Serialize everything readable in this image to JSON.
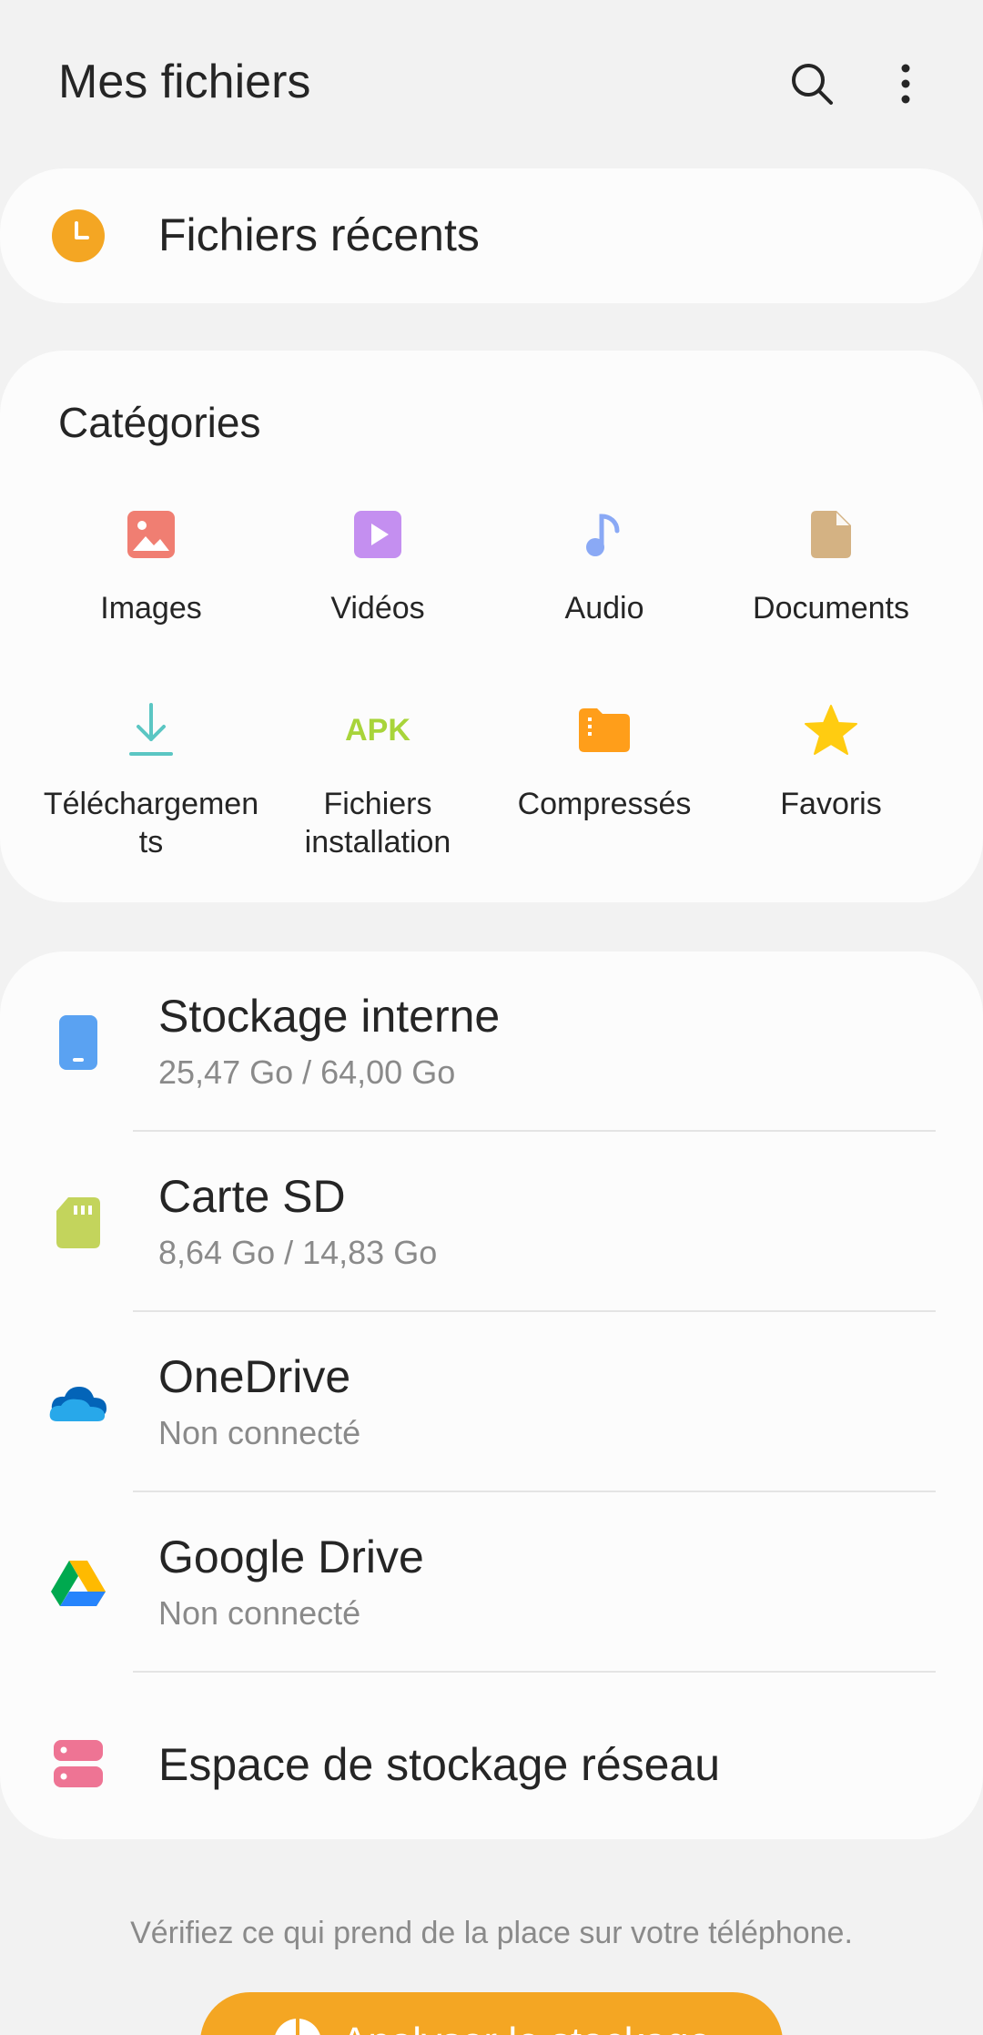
{
  "header": {
    "title": "Mes fichiers"
  },
  "recent": {
    "label": "Fichiers récents"
  },
  "categories": {
    "title": "Catégories",
    "items": [
      {
        "label": "Images"
      },
      {
        "label": "Vidéos"
      },
      {
        "label": "Audio"
      },
      {
        "label": "Documents"
      },
      {
        "label": "Téléchargemen\nts"
      },
      {
        "label": "Fichiers\ninstallation"
      },
      {
        "label": "Compressés"
      },
      {
        "label": "Favoris"
      }
    ],
    "apk_text": "APK"
  },
  "storage": {
    "items": [
      {
        "name": "Stockage interne",
        "sub": "25,47 Go / 64,00 Go"
      },
      {
        "name": "Carte SD",
        "sub": "8,64 Go / 14,83 Go"
      },
      {
        "name": "OneDrive",
        "sub": "Non connecté"
      },
      {
        "name": "Google Drive",
        "sub": "Non connecté"
      },
      {
        "name": "Espace de stockage réseau"
      }
    ]
  },
  "footer": {
    "hint": "Vérifiez ce qui prend de la place sur votre téléphone.",
    "analyze_label": "Analyser le stockage"
  },
  "colors": {
    "accent_orange": "#f4a623",
    "images": "#f07e72",
    "videos": "#c48ff0",
    "audio": "#8aa9f5",
    "documents": "#d4b283",
    "downloads": "#5bc6c3",
    "apk": "#a8d43a",
    "compressed": "#ff9e1a",
    "favorites": "#ffcc11",
    "internal": "#5aa2f2",
    "sdcard": "#c3d45c",
    "network": "#ee7494"
  }
}
